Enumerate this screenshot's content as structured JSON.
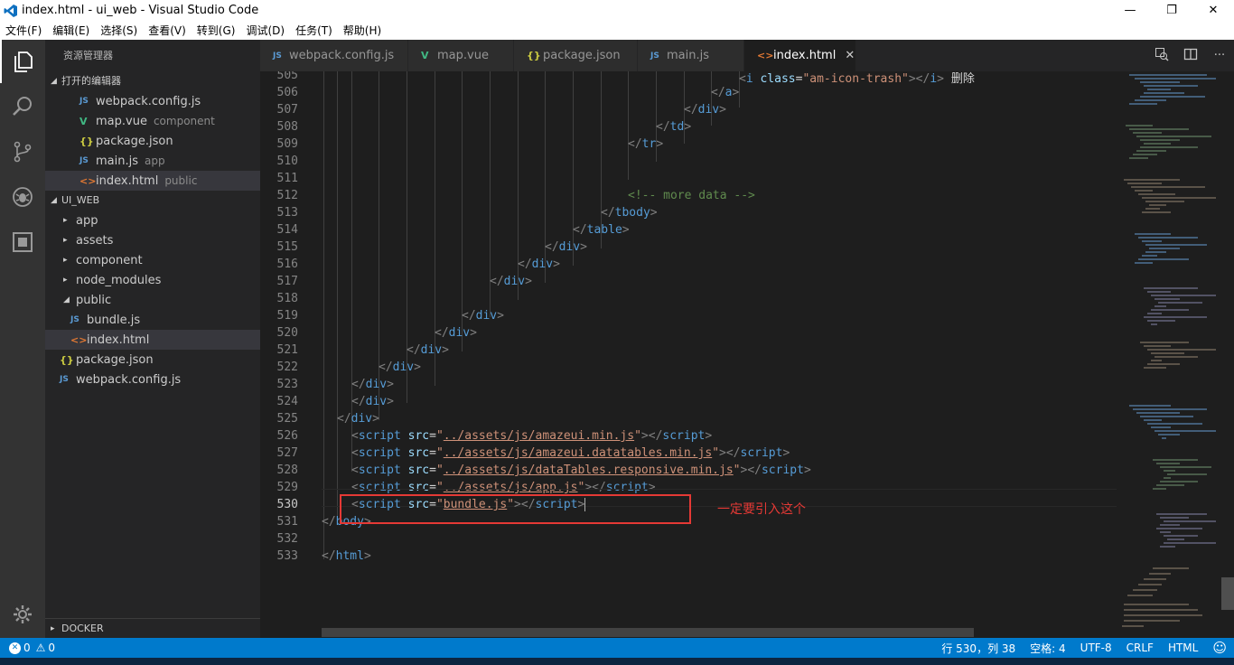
{
  "window": {
    "title": "index.html - ui_web - Visual Studio Code",
    "minimize": "—",
    "restore": "❐",
    "close": "✕"
  },
  "menu": [
    "文件(F)",
    "编辑(E)",
    "选择(S)",
    "查看(V)",
    "转到(G)",
    "调试(D)",
    "任务(T)",
    "帮助(H)"
  ],
  "activity": [
    "files-icon",
    "search-icon",
    "source-control-icon",
    "debug-icon",
    "extensions-icon",
    "gear-icon"
  ],
  "sidebar": {
    "title": "资源管理器",
    "open_editors_title": "打开的编辑器",
    "open_editors": [
      {
        "icon": "JS",
        "type": "js",
        "name": "webpack.config.js",
        "desc": ""
      },
      {
        "icon": "V",
        "type": "vue",
        "name": "map.vue",
        "desc": "component"
      },
      {
        "icon": "{}",
        "type": "json",
        "name": "package.json",
        "desc": ""
      },
      {
        "icon": "JS",
        "type": "js",
        "name": "main.js",
        "desc": "app"
      },
      {
        "icon": "<>",
        "type": "html",
        "name": "index.html",
        "desc": "public"
      }
    ],
    "project_title": "UI_WEB",
    "tree": [
      {
        "twisty": "▸",
        "name": "app"
      },
      {
        "twisty": "▸",
        "name": "assets"
      },
      {
        "twisty": "▸",
        "name": "component"
      },
      {
        "twisty": "▸",
        "name": "node_modules"
      },
      {
        "twisty": "◢",
        "name": "public"
      }
    ],
    "public_children": [
      {
        "icon": "JS",
        "type": "js",
        "name": "bundle.js"
      },
      {
        "icon": "<>",
        "type": "html",
        "name": "index.html"
      }
    ],
    "root_files": [
      {
        "icon": "{}",
        "type": "json",
        "name": "package.json"
      },
      {
        "icon": "JS",
        "type": "js",
        "name": "webpack.config.js"
      }
    ],
    "docker_title": "DOCKER"
  },
  "tabs": [
    {
      "icon": "JS",
      "type": "js",
      "label": "webpack.config.js"
    },
    {
      "icon": "V",
      "type": "vue",
      "label": "map.vue"
    },
    {
      "icon": "{}",
      "type": "json",
      "label": "package.json"
    },
    {
      "icon": "JS",
      "type": "js",
      "label": "main.js"
    },
    {
      "icon": "<>",
      "type": "html",
      "label": "index.html",
      "close": "✕"
    }
  ],
  "annotation": "一定要引入这个",
  "code": {
    "trash_label": "删除",
    "comment": "<!-- more data -->",
    "scripts": [
      "../assets/js/amazeui.min.js",
      "../assets/js/amazeui.datatables.min.js",
      "../assets/js/dataTables.responsive.min.js",
      "../assets/js/app.js",
      "bundle.js"
    ],
    "icon_class": "am-icon-trash"
  },
  "status": {
    "errors": "0",
    "warnings": "0",
    "position": "行 530，列 38",
    "spaces": "空格: 4",
    "encoding": "UTF-8",
    "eol": "CRLF",
    "language": "HTML",
    "feedback": "☺"
  },
  "colors": {
    "statusbar": "#007acc",
    "sidebar": "#252526",
    "editor": "#1e1e1e",
    "activitybar": "#333333",
    "annotation": "#e53935"
  }
}
